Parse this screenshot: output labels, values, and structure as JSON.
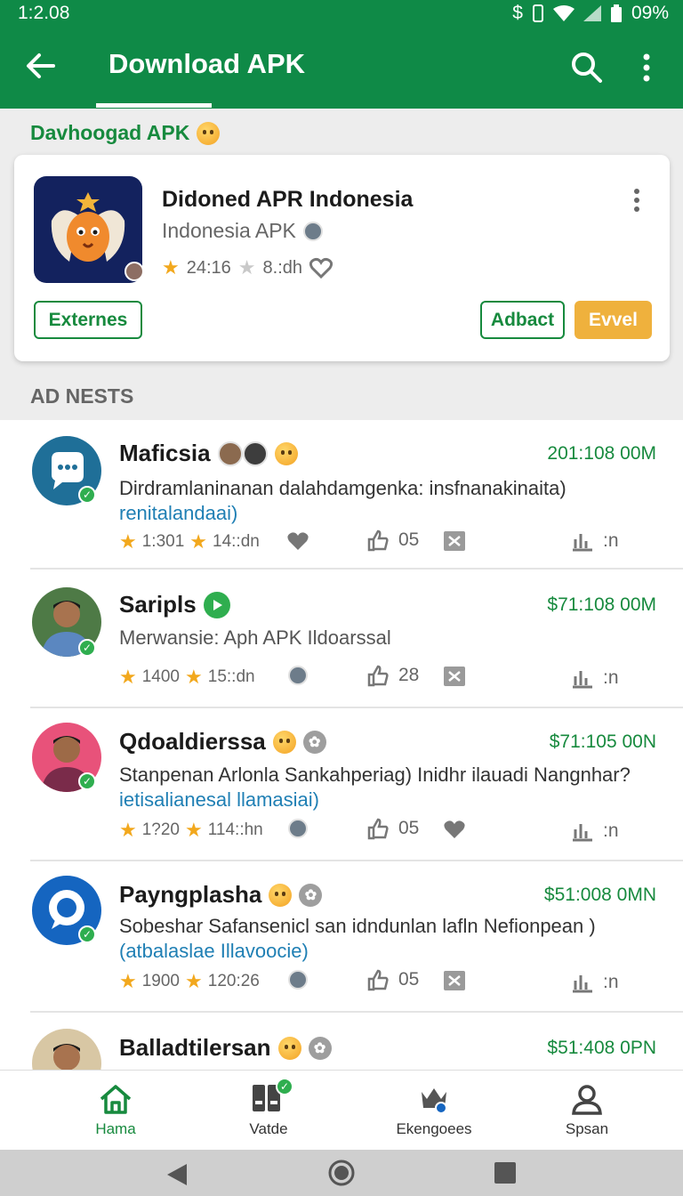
{
  "status_bar": {
    "time": "1:2.08",
    "battery": "09%"
  },
  "app_bar": {
    "title": "Download APK"
  },
  "featured": {
    "heading": "Davhoogad APK",
    "card": {
      "title": "Didoned APR Indonesia",
      "subtitle": "Indonesia APK",
      "rating": "24:16",
      "downloads": "8.:dh",
      "buttons": {
        "externes": "Externes",
        "adbact": "Adbact",
        "primary": "Evvel"
      }
    }
  },
  "ads_heading": "AD NESTS",
  "feed": [
    {
      "name": "Maficsia",
      "price": "201:108 00M",
      "desc": "Dirdramlaninanan dalahdamgenka: insfnanakinaita)",
      "tag": "renitalandaai)",
      "rating": "1:301",
      "time": "14::dn",
      "likes": "05",
      "more": ":n"
    },
    {
      "name": "Saripls",
      "price": "$71:108 00M",
      "desc": "Merwansie: Aph APK Ildoarssal",
      "tag": "",
      "rating": "1400",
      "time": "15::dn",
      "likes": "28",
      "more": ":n"
    },
    {
      "name": "Qdoaldierssa",
      "price": "$71:105 00N",
      "desc": "Stanpenan Arlonla Sankahperiag) Inidhr ilauadi Nangnhar?",
      "tag": "ietisalianesal llamasiai)",
      "rating": "1?20",
      "time": "114::hn",
      "likes": "05",
      "more": ":n"
    },
    {
      "name": "Payngplasha",
      "price": "$51:008 0MN",
      "desc": "Sobeshar Safansenicl san idndunlan lafln Nefionpean )",
      "tag": "(atbalaslae Illavoocie)",
      "rating": "1900",
      "time": "120:26",
      "likes": "05",
      "more": ":n"
    },
    {
      "name": "Balladtilersan",
      "price": "$51:408 0PN"
    }
  ],
  "bottom_nav": [
    {
      "label": "Hama"
    },
    {
      "label": "Vatde"
    },
    {
      "label": "Ekengoees"
    },
    {
      "label": "Spsan"
    }
  ],
  "colors": {
    "primary": "#0f8a47",
    "accent": "#efb13d",
    "link": "#1f7fb4"
  },
  "icons": [
    "back-arrow-icon",
    "search-icon",
    "more-vert-icon",
    "star-icon",
    "heart-icon",
    "thumbs-up-icon",
    "share-icon",
    "chart-icon",
    "home-icon",
    "apps-icon",
    "crown-icon",
    "person-icon"
  ]
}
